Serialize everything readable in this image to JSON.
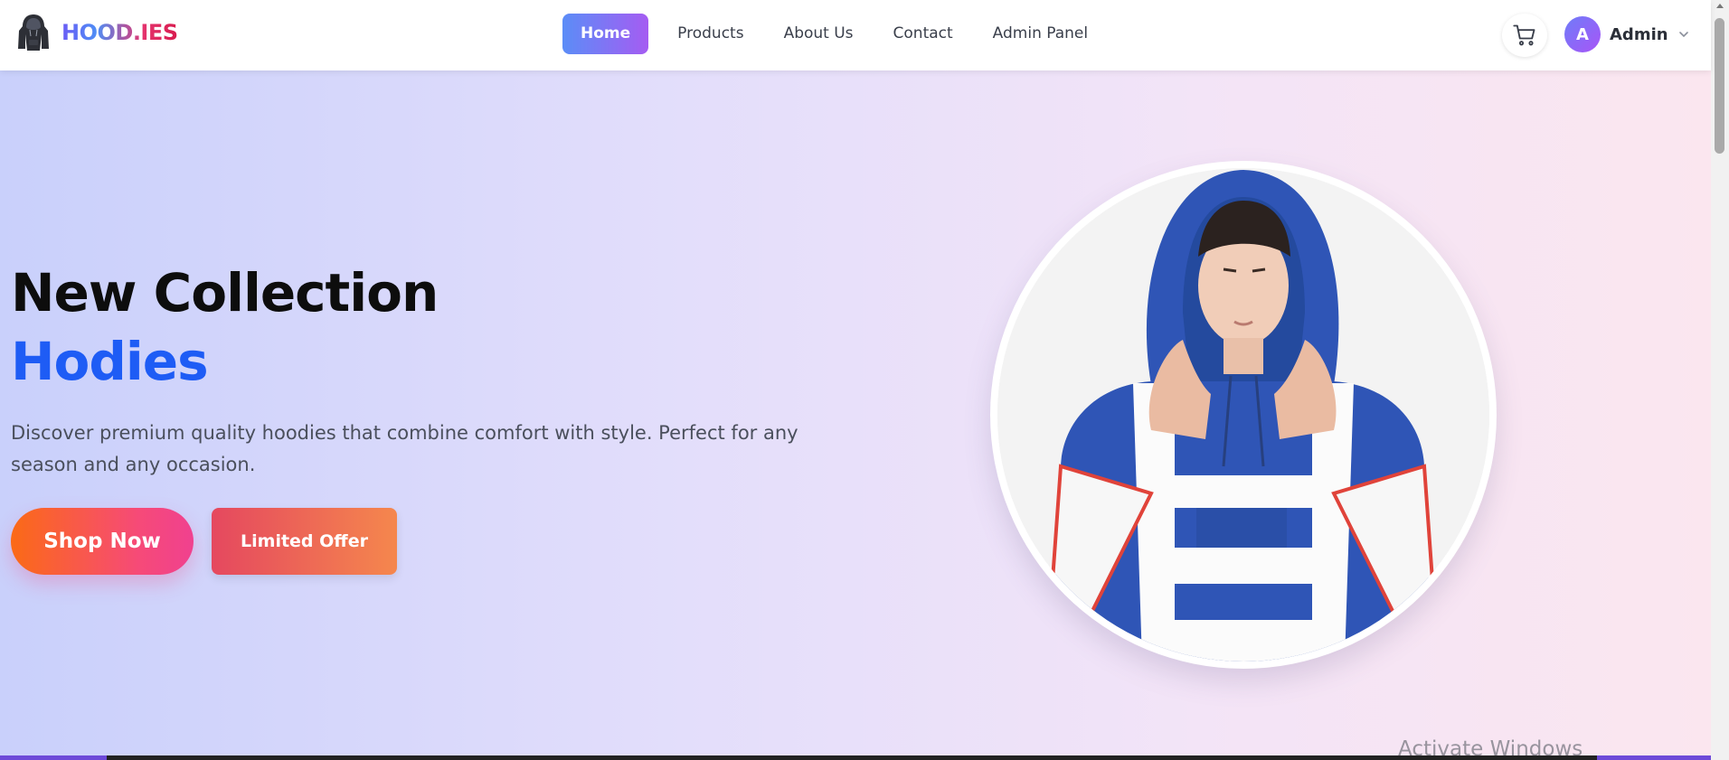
{
  "brand": {
    "name": "HOOD.IES",
    "logo_icon": "hoodie-icon"
  },
  "nav": {
    "items": [
      {
        "label": "Home",
        "active": true
      },
      {
        "label": "Products",
        "active": false
      },
      {
        "label": "About Us",
        "active": false
      },
      {
        "label": "Contact",
        "active": false
      },
      {
        "label": "Admin Panel",
        "active": false
      }
    ]
  },
  "header": {
    "cart_icon": "cart-icon",
    "user": {
      "initial": "A",
      "name": "Admin",
      "menu_icon": "chevron-down-icon"
    }
  },
  "hero": {
    "title_line1": "New Collection",
    "title_line2": "Hodies",
    "description": "Discover premium quality hoodies that combine comfort with style. Perfect for any season and any occasion.",
    "primary_button": "Shop Now",
    "secondary_button": "Limited Offer"
  },
  "overlay": {
    "watermark": "Activate Windows"
  },
  "colors": {
    "accent_blue": "#1e5cf5",
    "nav_active_start": "#5b8df7",
    "nav_active_end": "#a55cf2",
    "shop_gradient_start": "#fb6a16",
    "shop_gradient_end": "#f0418f",
    "offer_gradient_start": "#e5485f",
    "offer_gradient_end": "#f5874d"
  }
}
